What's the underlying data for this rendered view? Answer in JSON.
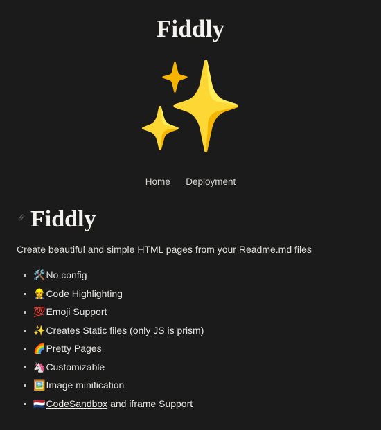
{
  "header": {
    "title": "Fiddly",
    "hero_emoji": "✨",
    "hero_emoji_name": "sparkles-emoji"
  },
  "nav": {
    "items": [
      {
        "label": "Home"
      },
      {
        "label": "Deployment"
      }
    ]
  },
  "doc": {
    "anchor_icon": "link-icon",
    "title": "Fiddly",
    "lead": "Create beautiful and simple HTML pages from your Readme.md files"
  },
  "features": [
    {
      "emoji": "🛠️",
      "emoji_name": "hammer-and-wrench-emoji",
      "text": "No config"
    },
    {
      "emoji": "👷",
      "emoji_name": "construction-worker-emoji",
      "text": "Code Highlighting"
    },
    {
      "emoji": "💯",
      "emoji_name": "hundred-points-emoji",
      "text": "Emoji Support"
    },
    {
      "emoji": "✨",
      "emoji_name": "sparkles-emoji",
      "text": "Creates Static files (only JS is prism)"
    },
    {
      "emoji": "🌈",
      "emoji_name": "rainbow-emoji",
      "text": "Pretty Pages"
    },
    {
      "emoji": "🦄",
      "emoji_name": "unicorn-emoji",
      "text": "Customizable"
    },
    {
      "emoji": "🖼️",
      "emoji_name": "framed-picture-emoji",
      "text": "Image minification"
    },
    {
      "emoji": "🇳🇱",
      "emoji_name": "netherlands-flag-emoji",
      "text": "",
      "link_label": "CodeSandbox",
      "suffix": " and iframe Support"
    }
  ],
  "colors": {
    "background": "#1b1b1b",
    "text": "#e8e6e3",
    "muted": "#5d5b58",
    "link": "#eceae6"
  }
}
